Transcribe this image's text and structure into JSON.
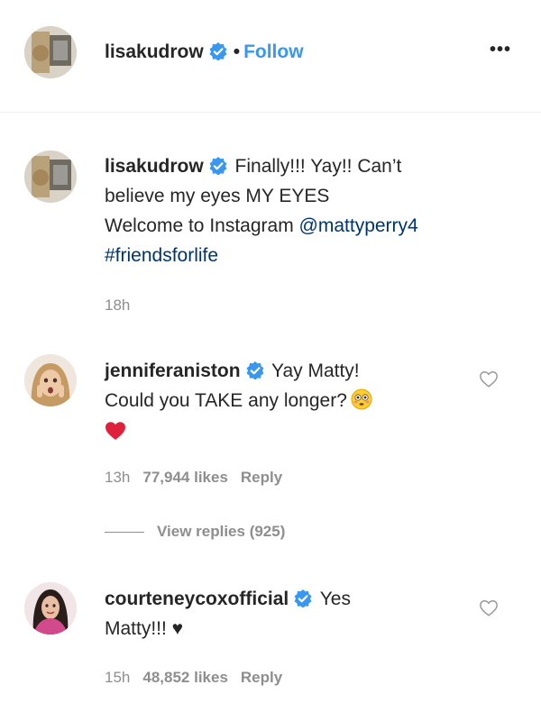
{
  "header": {
    "username": "lisakudrow",
    "separator": "•",
    "follow_label": "Follow",
    "more_label": "•••"
  },
  "caption": {
    "username": "lisakudrow",
    "line1": "Finally!!! Yay!! Can’t",
    "line2": "believe my eyes MY EYES",
    "line3_text": "Welcome to Instagram ",
    "mention": "@mattyperry4",
    "hashtag": "#friendsforlife",
    "time": "18h"
  },
  "comments": [
    {
      "username": "jenniferaniston",
      "line1": "Yay Matty!",
      "line2": "Could you TAKE any longer?",
      "emoji1": "flushed-face-emoji",
      "emoji2": "red-heart-emoji",
      "time": "13h",
      "likes": "77,944 likes",
      "reply_label": "Reply",
      "view_replies": "View replies (925)"
    },
    {
      "username": "courteneycoxofficial",
      "line1": "Yes",
      "line2": "Matty!!! ♥",
      "time": "15h",
      "likes": "48,852 likes",
      "reply_label": "Reply"
    }
  ],
  "colors": {
    "link": "#003569",
    "follow": "#3897f0",
    "verified": "#3897f0",
    "meta": "#8e8e8e"
  }
}
